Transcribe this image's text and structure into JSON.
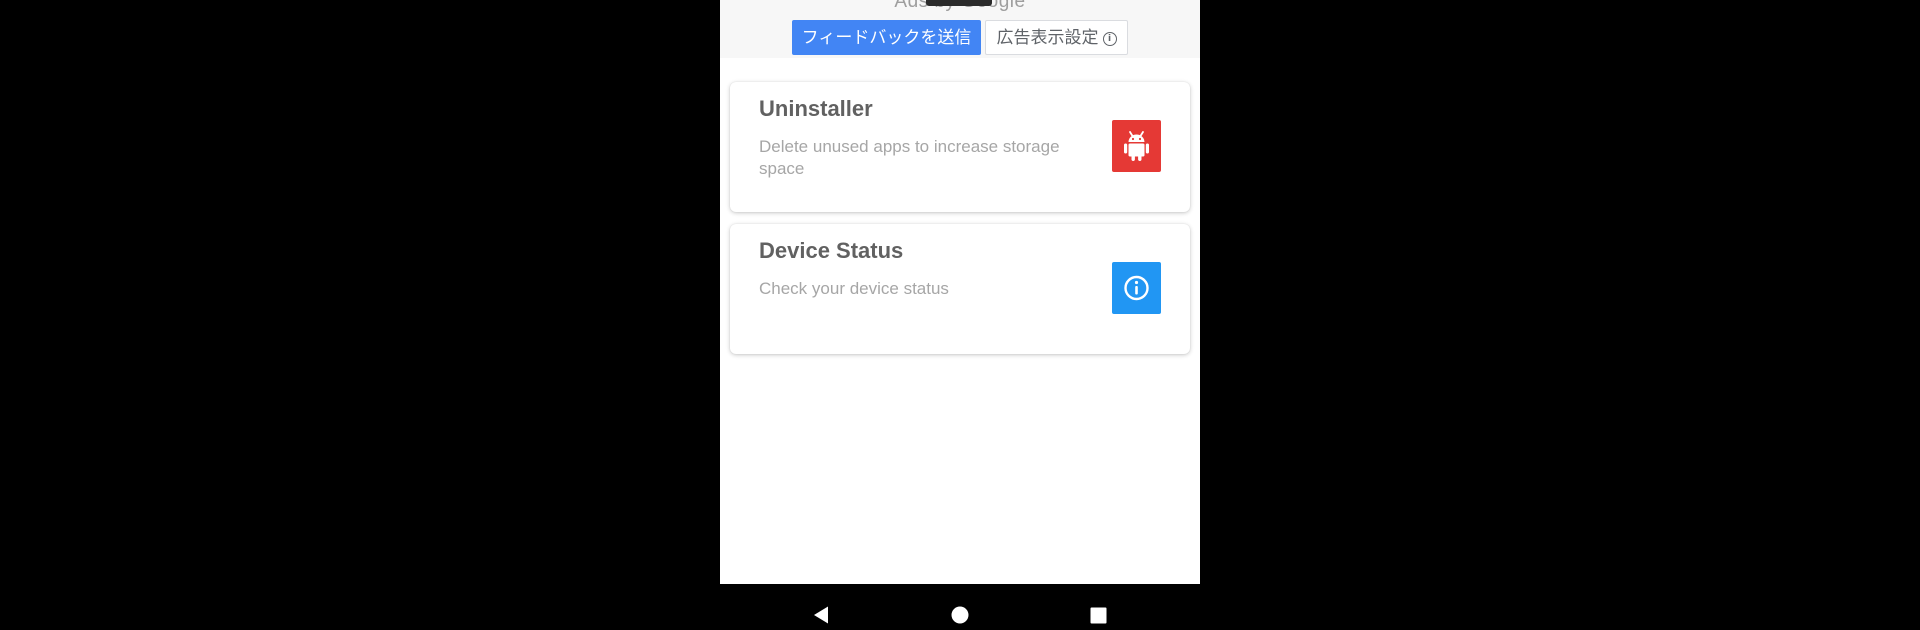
{
  "ad_banner": {
    "caption": "Ads by Google",
    "tooltip": "",
    "feedback_label": "フィードバックを送信",
    "settings_label": "広告表示設定",
    "settings_icon": "info-icon"
  },
  "cards": [
    {
      "title": "Uninstaller",
      "description": "Delete unused apps to increase storage space",
      "icon": "android-icon",
      "icon_color": "#e53935"
    },
    {
      "title": "Device Status",
      "description": "Check your device status",
      "icon": "info-circle-icon",
      "icon_color": "#2196f3"
    }
  ],
  "nav_bar": {
    "back_icon": "back-triangle-icon",
    "home_icon": "home-circle-icon",
    "recent_icon": "recent-square-icon"
  },
  "colors": {
    "ad_button": "#4285f4",
    "card_title": "#616161",
    "card_desc": "#a6a6a6"
  }
}
